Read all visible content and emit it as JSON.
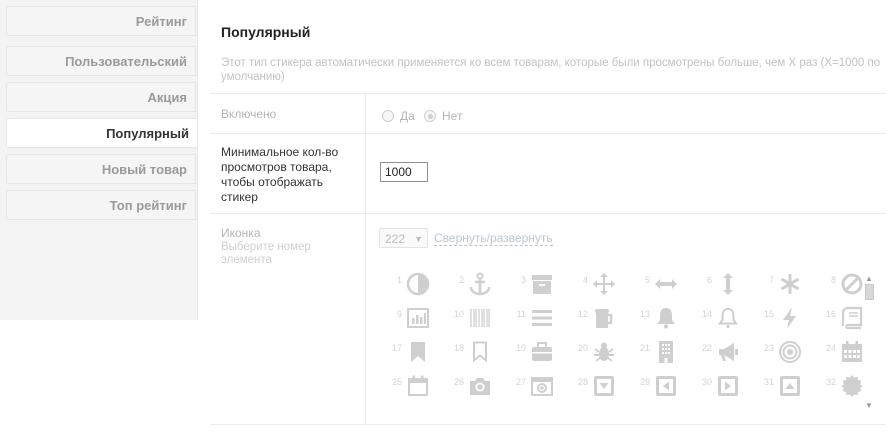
{
  "sidebar": {
    "items": [
      {
        "label": "Рейтинг",
        "active": false
      },
      {
        "label": "Пользовательский",
        "active": false
      },
      {
        "label": "Акция",
        "active": false
      },
      {
        "label": "Популярный",
        "active": true
      },
      {
        "label": "Новый товар",
        "active": false
      },
      {
        "label": "Топ рейтинг",
        "active": false
      }
    ]
  },
  "main": {
    "title": "Популярный",
    "description": "Этот тип стикера автоматически применяется ко всем товарам, которые были просмотрены больше, чем X раз (X=1000 по умолчанию)",
    "enabled": {
      "label": "Включено",
      "yes": "Да",
      "no": "Нет",
      "selected": "Нет"
    },
    "min_views": {
      "label": "Минимальное кол-во просмотров товара, чтобы отображать стикер",
      "value": "1000"
    },
    "icon": {
      "label": "Иконка",
      "hint": "Выберите номер элемента",
      "selected": "222",
      "toggle_link": "Свернуть/развернуть",
      "grid": [
        {
          "n": "1",
          "icon": "contrast-icon"
        },
        {
          "n": "2",
          "icon": "anchor-icon"
        },
        {
          "n": "3",
          "icon": "archive-icon"
        },
        {
          "n": "4",
          "icon": "move-arrows-icon"
        },
        {
          "n": "5",
          "icon": "horizontal-arrows-icon"
        },
        {
          "n": "6",
          "icon": "vertical-arrows-icon"
        },
        {
          "n": "7",
          "icon": "asterisk-icon"
        },
        {
          "n": "8",
          "icon": "ban-icon"
        },
        {
          "n": "9",
          "icon": "bar-chart-icon"
        },
        {
          "n": "10",
          "icon": "barcode-icon"
        },
        {
          "n": "11",
          "icon": "list-icon"
        },
        {
          "n": "12",
          "icon": "beer-icon"
        },
        {
          "n": "13",
          "icon": "bell-filled-icon"
        },
        {
          "n": "14",
          "icon": "bell-outline-icon"
        },
        {
          "n": "15",
          "icon": "bolt-icon"
        },
        {
          "n": "16",
          "icon": "book-icon"
        },
        {
          "n": "17",
          "icon": "bookmark-filled-icon"
        },
        {
          "n": "18",
          "icon": "bookmark-outline-icon"
        },
        {
          "n": "19",
          "icon": "briefcase-icon"
        },
        {
          "n": "20",
          "icon": "bug-icon"
        },
        {
          "n": "21",
          "icon": "building-icon"
        },
        {
          "n": "22",
          "icon": "bullhorn-icon"
        },
        {
          "n": "23",
          "icon": "bullseye-icon"
        },
        {
          "n": "24",
          "icon": "calendar-filled-icon"
        },
        {
          "n": "25",
          "icon": "calendar-outline-icon"
        },
        {
          "n": "26",
          "icon": "camera-icon"
        },
        {
          "n": "27",
          "icon": "camera-retro-icon"
        },
        {
          "n": "28",
          "icon": "caret-square-down-icon"
        },
        {
          "n": "29",
          "icon": "caret-square-left-icon"
        },
        {
          "n": "30",
          "icon": "caret-square-right-icon"
        },
        {
          "n": "31",
          "icon": "caret-square-up-icon"
        },
        {
          "n": "32",
          "icon": "certificate-icon"
        }
      ]
    }
  },
  "colors": {
    "icon_gray": "#cfcfcf",
    "active_text": "#333333",
    "inactive_text": "#9a9a9a"
  }
}
